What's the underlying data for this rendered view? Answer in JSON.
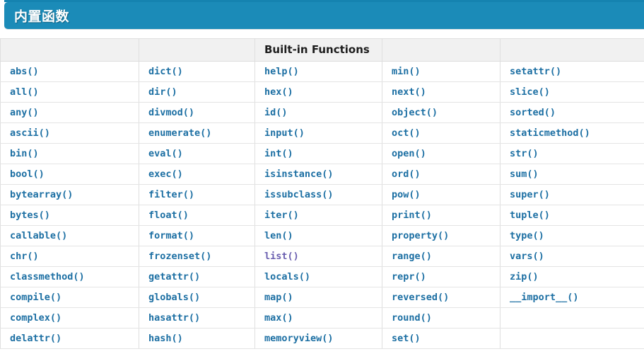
{
  "header": {
    "title": "内置函数",
    "bar_color": "#1b8bb8",
    "bar_top_strip_color": "#1583b0",
    "title_color": "#ffffff"
  },
  "table": {
    "caption": "Built-in Functions",
    "header_cells": [
      "",
      "",
      "Built-in Functions",
      "",
      ""
    ],
    "link_color": "#1c6fa3",
    "visited_link_color": "#6a5fb0",
    "header_bg": "#f1f1f1",
    "border_color": "#dfdfdf",
    "columns": 5,
    "rows": [
      [
        {
          "label": "abs()",
          "visited": false
        },
        {
          "label": "dict()",
          "visited": false
        },
        {
          "label": "help()",
          "visited": false
        },
        {
          "label": "min()",
          "visited": false
        },
        {
          "label": "setattr()",
          "visited": false
        }
      ],
      [
        {
          "label": "all()",
          "visited": false
        },
        {
          "label": "dir()",
          "visited": false
        },
        {
          "label": "hex()",
          "visited": false
        },
        {
          "label": "next()",
          "visited": false
        },
        {
          "label": "slice()",
          "visited": false
        }
      ],
      [
        {
          "label": "any()",
          "visited": false
        },
        {
          "label": "divmod()",
          "visited": false
        },
        {
          "label": "id()",
          "visited": false
        },
        {
          "label": "object()",
          "visited": false
        },
        {
          "label": "sorted()",
          "visited": false
        }
      ],
      [
        {
          "label": "ascii()",
          "visited": false
        },
        {
          "label": "enumerate()",
          "visited": false
        },
        {
          "label": "input()",
          "visited": false
        },
        {
          "label": "oct()",
          "visited": false
        },
        {
          "label": "staticmethod()",
          "visited": false
        }
      ],
      [
        {
          "label": "bin()",
          "visited": false
        },
        {
          "label": "eval()",
          "visited": false
        },
        {
          "label": "int()",
          "visited": false
        },
        {
          "label": "open()",
          "visited": false
        },
        {
          "label": "str()",
          "visited": false
        }
      ],
      [
        {
          "label": "bool()",
          "visited": false
        },
        {
          "label": "exec()",
          "visited": false
        },
        {
          "label": "isinstance()",
          "visited": false
        },
        {
          "label": "ord()",
          "visited": false
        },
        {
          "label": "sum()",
          "visited": false
        }
      ],
      [
        {
          "label": "bytearray()",
          "visited": false
        },
        {
          "label": "filter()",
          "visited": false
        },
        {
          "label": "issubclass()",
          "visited": false
        },
        {
          "label": "pow()",
          "visited": false
        },
        {
          "label": "super()",
          "visited": false
        }
      ],
      [
        {
          "label": "bytes()",
          "visited": false
        },
        {
          "label": "float()",
          "visited": false
        },
        {
          "label": "iter()",
          "visited": false
        },
        {
          "label": "print()",
          "visited": false
        },
        {
          "label": "tuple()",
          "visited": false
        }
      ],
      [
        {
          "label": "callable()",
          "visited": false
        },
        {
          "label": "format()",
          "visited": false
        },
        {
          "label": "len()",
          "visited": false
        },
        {
          "label": "property()",
          "visited": false
        },
        {
          "label": "type()",
          "visited": false
        }
      ],
      [
        {
          "label": "chr()",
          "visited": false
        },
        {
          "label": "frozenset()",
          "visited": false
        },
        {
          "label": "list()",
          "visited": true
        },
        {
          "label": "range()",
          "visited": false
        },
        {
          "label": "vars()",
          "visited": false
        }
      ],
      [
        {
          "label": "classmethod()",
          "visited": false
        },
        {
          "label": "getattr()",
          "visited": false
        },
        {
          "label": "locals()",
          "visited": false
        },
        {
          "label": "repr()",
          "visited": false
        },
        {
          "label": "zip()",
          "visited": false
        }
      ],
      [
        {
          "label": "compile()",
          "visited": false
        },
        {
          "label": "globals()",
          "visited": false
        },
        {
          "label": "map()",
          "visited": false
        },
        {
          "label": "reversed()",
          "visited": false
        },
        {
          "label": "__import__()",
          "visited": false
        }
      ],
      [
        {
          "label": "complex()",
          "visited": false
        },
        {
          "label": "hasattr()",
          "visited": false
        },
        {
          "label": "max()",
          "visited": false
        },
        {
          "label": "round()",
          "visited": false
        },
        {
          "label": "",
          "visited": false
        }
      ],
      [
        {
          "label": "delattr()",
          "visited": false
        },
        {
          "label": "hash()",
          "visited": false
        },
        {
          "label": "memoryview()",
          "visited": false
        },
        {
          "label": "set()",
          "visited": false
        },
        {
          "label": "",
          "visited": false
        }
      ]
    ]
  }
}
